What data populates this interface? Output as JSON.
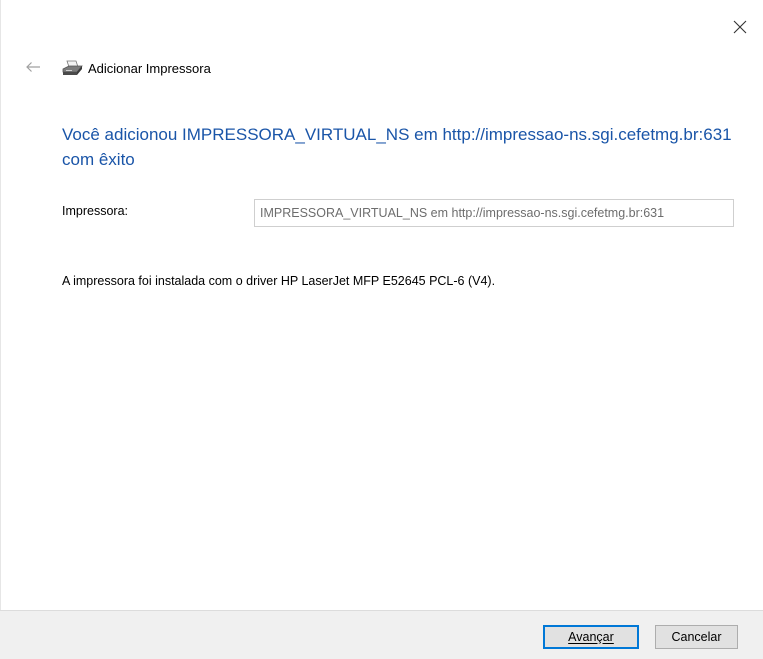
{
  "window": {
    "close_icon": "close-icon"
  },
  "header": {
    "back_icon": "back-arrow-icon",
    "printer_icon": "printer-icon",
    "title": "Adicionar Impressora"
  },
  "main": {
    "headline": "Você adicionou IMPRESSORA_VIRTUAL_NS em http://impressao-ns.sgi.cefetmg.br:631 com êxito",
    "printer_label": "Impressora:",
    "printer_value": "IMPRESSORA_VIRTUAL_NS em http://impressao-ns.sgi.cefetmg.br:631",
    "driver_text": "A impressora foi instalada com o driver HP LaserJet MFP E52645 PCL-6 (V4)."
  },
  "footer": {
    "next_label": "Avançar",
    "cancel_label": "Cancelar"
  },
  "colors": {
    "headline": "#1a55a8",
    "accent_border": "#0078d7",
    "footer_bg": "#f0f0f0"
  }
}
